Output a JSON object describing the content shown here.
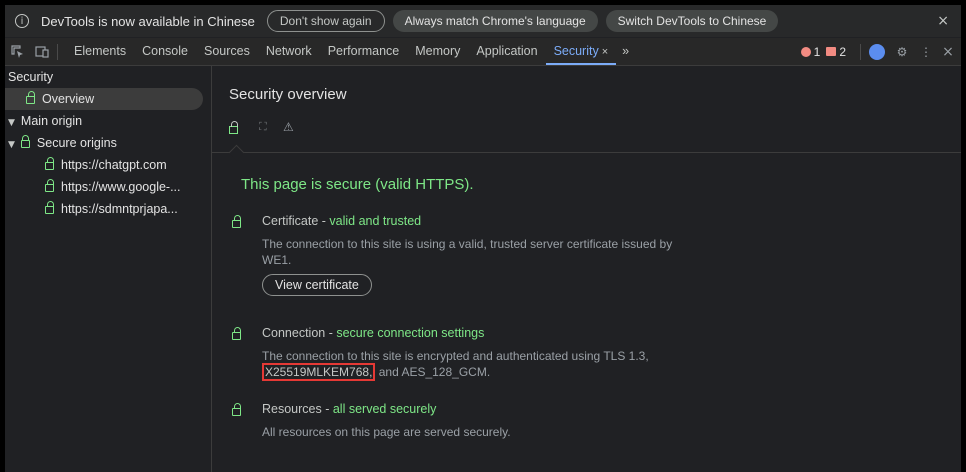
{
  "infobar": {
    "message": "DevTools is now available in Chinese",
    "dont_show": "Don't show again",
    "always_match": "Always match Chrome's language",
    "switch": "Switch DevTools to Chinese",
    "close": "×"
  },
  "toolbar": {
    "tabs": [
      "Elements",
      "Console",
      "Sources",
      "Network",
      "Performance",
      "Memory",
      "Application",
      "Security"
    ],
    "active_tab": "Security",
    "more": "»",
    "errors_count": "1",
    "issues_count": "2",
    "close": "×",
    "menu": "⋮"
  },
  "sidebar": {
    "header": "Security",
    "overview": "Overview",
    "main_origin": "Main origin",
    "secure_origins": "Secure origins",
    "origins": [
      "https://chatgpt.com",
      "https://www.google-...",
      "https://sdmntprjapa..."
    ]
  },
  "main": {
    "title": "Security overview",
    "secure_message": "This page is secure (valid HTTPS).",
    "certificate": {
      "label": "Certificate",
      "status": "valid and trusted",
      "description": "The connection to this site is using a valid, trusted server certificate issued by WE1.",
      "button": "View certificate"
    },
    "connection": {
      "label": "Connection",
      "status": "secure connection settings",
      "desc_prefix": "The connection to this site is encrypted and authenticated using TLS 1.3,",
      "highlighted": "X25519MLKEM768,",
      "desc_suffix": "and AES_128_GCM."
    },
    "resources": {
      "label": "Resources",
      "status": "all served securely",
      "description": "All resources on this page are served securely."
    }
  },
  "colors": {
    "accent": "#7cacf8",
    "secure_green": "#7ee787",
    "error_red": "#f28b82",
    "highlight_red": "#e53935"
  }
}
